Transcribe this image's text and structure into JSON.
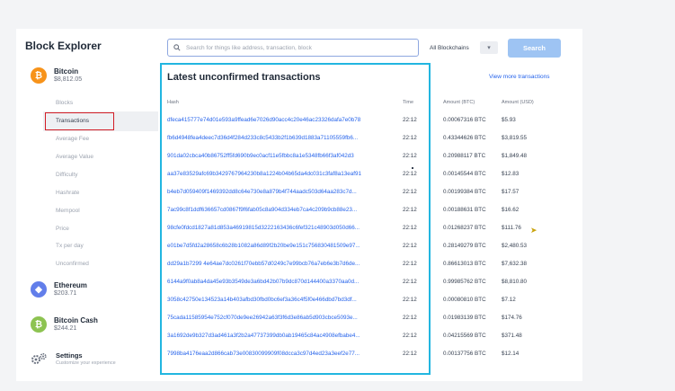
{
  "app": {
    "title": "Block Explorer"
  },
  "search": {
    "placeholder": "Search for things like address, transaction, block",
    "button": "Search",
    "chain_selector": "All Blockchains"
  },
  "sidebar": {
    "bitcoin": {
      "name": "Bitcoin",
      "price": "$8,812.05"
    },
    "bitcoin_nav": [
      {
        "label": "Blocks"
      },
      {
        "label": "Transactions"
      },
      {
        "label": "Average Fee"
      },
      {
        "label": "Average Value"
      },
      {
        "label": "Difficulty"
      },
      {
        "label": "Hashrate"
      },
      {
        "label": "Mempool"
      },
      {
        "label": "Price"
      },
      {
        "label": "Tx per day"
      },
      {
        "label": "Unconfirmed"
      }
    ],
    "ethereum": {
      "name": "Ethereum",
      "price": "$203.71"
    },
    "bitcoin_cash": {
      "name": "Bitcoin Cash",
      "price": "$244.21"
    },
    "settings": {
      "name": "Settings",
      "sub": "Customize your experience"
    }
  },
  "main": {
    "title": "Latest unconfirmed transactions",
    "view_more": "View more transactions",
    "columns": {
      "hash": "Hash",
      "time": "Time",
      "btc": "Amount (BTC)",
      "usd": "Amount (USD)"
    },
    "rows": [
      {
        "hash": "dfeca415777e74d01e593a9ffead6e7026d90acc4c20e46ac23326dafa7e0b78",
        "time": "22:12",
        "btc": "0.00067316 BTC",
        "usd": "$5.93"
      },
      {
        "hash": "fb6d4948fea4deec7d36d4f284d233c8c5433b2f1b639d1883a71105559fb6...",
        "time": "22:12",
        "btc": "0.43344626 BTC",
        "usd": "$3,819.55"
      },
      {
        "hash": "901da02cbca40b86752ff5fd690b9ec0acf11e5fbbc8a1e5348fb66f3af042d3",
        "time": "22:12",
        "btc": "0.20988117 BTC",
        "usd": "$1,849.48"
      },
      {
        "hash": "aa37e83529afc69b3429767964230b8a1224b04b65da4dc031c3faf8a13eaf91",
        "time": "22:12",
        "btc": "0.00145544 BTC",
        "usd": "$12.83"
      },
      {
        "hash": "b4eb7d059409f1469392dd8c64e730e8a879b4f744aadc503d64aa283c7d...",
        "time": "22:12",
        "btc": "0.00199384 BTC",
        "usd": "$17.57"
      },
      {
        "hash": "7ac99c8f1ddf636657cd0867f9f6fab05c8a904d334eb7ca4c209b9cb88e23...",
        "time": "22:12",
        "btc": "0.00188631 BTC",
        "usd": "$16.62"
      },
      {
        "hash": "98cfe0fdcd1827a81d853a46919815d3222163436c6fef321c48903d050d66...",
        "time": "22:12",
        "btc": "0.01268237 BTC",
        "usd": "$111.76"
      },
      {
        "hash": "e01be7d5fd2a28658c6b28b1082a86d89f2b20be9e151c756830481509e97...",
        "time": "22:12",
        "btc": "0.28149279 BTC",
        "usd": "$2,480.53"
      },
      {
        "hash": "dd29a1b7299 4e64ae7dc0261f70ebb57d0249c7e99bcb76a7eb6e3b7d6de...",
        "time": "22:12",
        "btc": "0.86613013 BTC",
        "usd": "$7,632.38"
      },
      {
        "hash": "6144a9f0ab8a4da45e93b3549de3a6bd42b07b9dc870d144400a3370aa0d...",
        "time": "22:12",
        "btc": "0.99985762 BTC",
        "usd": "$8,810.80"
      },
      {
        "hash": "3058c42750e134523a14b403afbd30fbd0bc6ef3a36c4f5f0e466dbd7bd3df...",
        "time": "22:12",
        "btc": "0.00080810 BTC",
        "usd": "$7.12"
      },
      {
        "hash": "75cada11585954e752cf070de9ee26942a63f3f6d3e86ab5d903cbce5093e...",
        "time": "22:12",
        "btc": "0.01983139 BTC",
        "usd": "$174.76"
      },
      {
        "hash": "3a1692de9b327d3ad461a3f2b2a47737399db0ab19465c84ac4908efbabe4...",
        "time": "22:12",
        "btc": "0.04215569 BTC",
        "usd": "$371.48"
      },
      {
        "hash": "7998ba4176eaa2d866cab73e00830099909f08dcca3c97d4ed23a3eef2e77...",
        "time": "22:12",
        "btc": "0.00137756 BTC",
        "usd": "$12.14"
      }
    ]
  },
  "colors": {
    "highlight_box": "#22b6e0",
    "nav_highlight": "#d21d26",
    "bitcoin": "#f7931a",
    "ethereum": "#627eea",
    "bitcoin_cash": "#8dc351",
    "link": "#2563eb",
    "search_button": "#9ec4f3"
  },
  "icons": {
    "bitcoin": "bitcoin-icon",
    "ethereum": "ethereum-icon",
    "bitcoin_cash": "bitcoin-cash-icon",
    "settings": "gears-icon",
    "search": "search-icon",
    "dropdown": "chevron-down-icon"
  }
}
